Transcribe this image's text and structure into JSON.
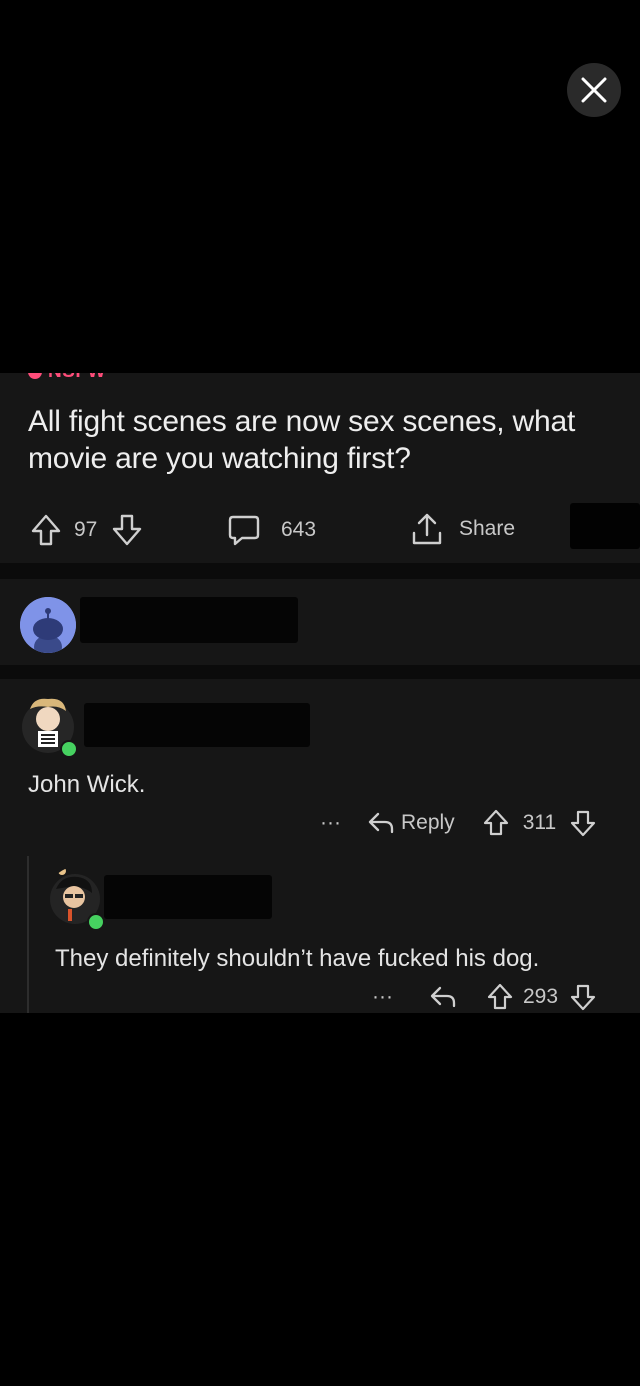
{
  "post": {
    "nsfw_label": "NSFW",
    "title": "All fight scenes are now sex scenes, what movie are you watching first?",
    "upvotes": "97",
    "comments": "643",
    "share_label": "Share"
  },
  "comments": [
    {
      "text": "John Wick.",
      "reply_label": "Reply",
      "score": "311",
      "more": "···"
    },
    {
      "text": "They definitely shouldn’t have fucked his dog.",
      "score": "293",
      "more": "···"
    }
  ],
  "colors": {
    "background": "#000000",
    "card": "#161616",
    "nsfw": "#ff4d7a",
    "online": "#46d160"
  }
}
